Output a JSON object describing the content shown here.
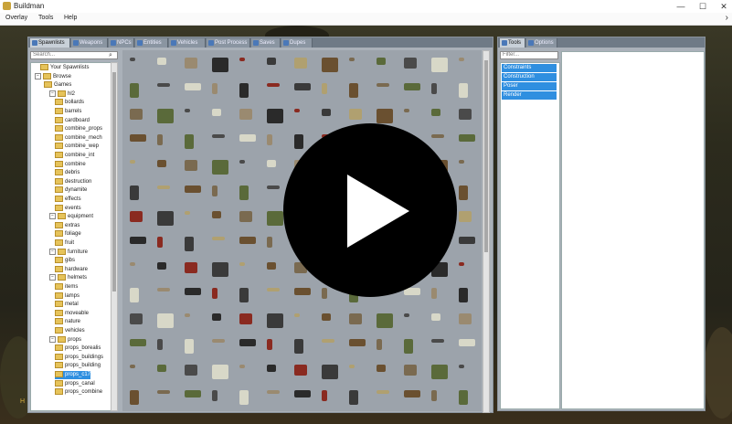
{
  "window": {
    "title": "Buildman",
    "minimize_label": "—",
    "maximize_label": "☐",
    "close_label": "✕"
  },
  "menu": {
    "items": [
      "Overlay",
      "Tools",
      "Help"
    ],
    "expand_label": "›"
  },
  "left_panel": {
    "tabs": [
      "Spawnlists",
      "Weapons",
      "NPCs",
      "Entities",
      "Vehicles",
      "Post Process",
      "Saves",
      "Dupes"
    ],
    "search_placeholder": "Search...",
    "tree": [
      "Your Spawnlists",
      "Browse",
      "Games",
      "hl2",
      "bollards",
      "barrels",
      "cardboard",
      "combine_props",
      "combine_mech",
      "combine_wep",
      "combine_int",
      "combine",
      "debris",
      "destruction",
      "dynamite",
      "effects",
      "events",
      "equipment",
      "extras",
      "foliage",
      "fruit",
      "furniture",
      "gibs",
      "hardware",
      "helmets",
      "items",
      "lamps",
      "metal",
      "moveable",
      "nature",
      "vehicles",
      "props",
      "props_borealis",
      "props_buildings",
      "props_building",
      "props_c17",
      "props_canal",
      "props_combine"
    ]
  },
  "right_panel": {
    "tabs": [
      "Tools",
      "Options"
    ],
    "filter_placeholder": "Filter...",
    "items": [
      "Constraints",
      "Construction",
      "Poser",
      "Render"
    ]
  },
  "overlay": {
    "icon": "play-icon"
  },
  "hud": {
    "text": "H"
  }
}
